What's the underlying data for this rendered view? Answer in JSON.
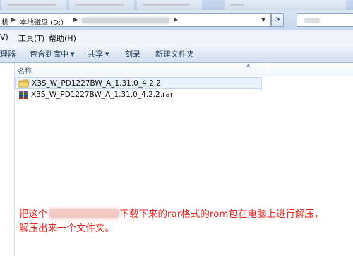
{
  "address_bar": {
    "left_crumb": "机",
    "drive_label": "本地磁盘 (D:)"
  },
  "menu": {
    "items": [
      "V)",
      "工具(T)",
      "帮助(H)"
    ]
  },
  "toolbar": {
    "organize_partial": "理器",
    "include_in_library": "包含到库中",
    "share": "共享",
    "burn": "刻录",
    "new_folder": "新建文件夹"
  },
  "file_list": {
    "column_name": "名称",
    "files": [
      {
        "name": "X3S_W_PD1227BW_A_1.31.0_4.2.2",
        "type": "folder",
        "selected": true
      },
      {
        "name": "X3S_W_PD1227BW_A_1.31.0_4.2.2.rar",
        "type": "rar-archive",
        "selected": false
      }
    ]
  },
  "annotation": {
    "line1_before": "把这个",
    "line1_after": "下载下来的rar格式的rom包在电脑上进行解压，",
    "line2": "解压出来一个文件夹。",
    "color": "#e8231c"
  },
  "colors": {
    "accent": "#2a4a78",
    "selection": "#eaf2fb",
    "toolbar_text": "#1e395b"
  }
}
